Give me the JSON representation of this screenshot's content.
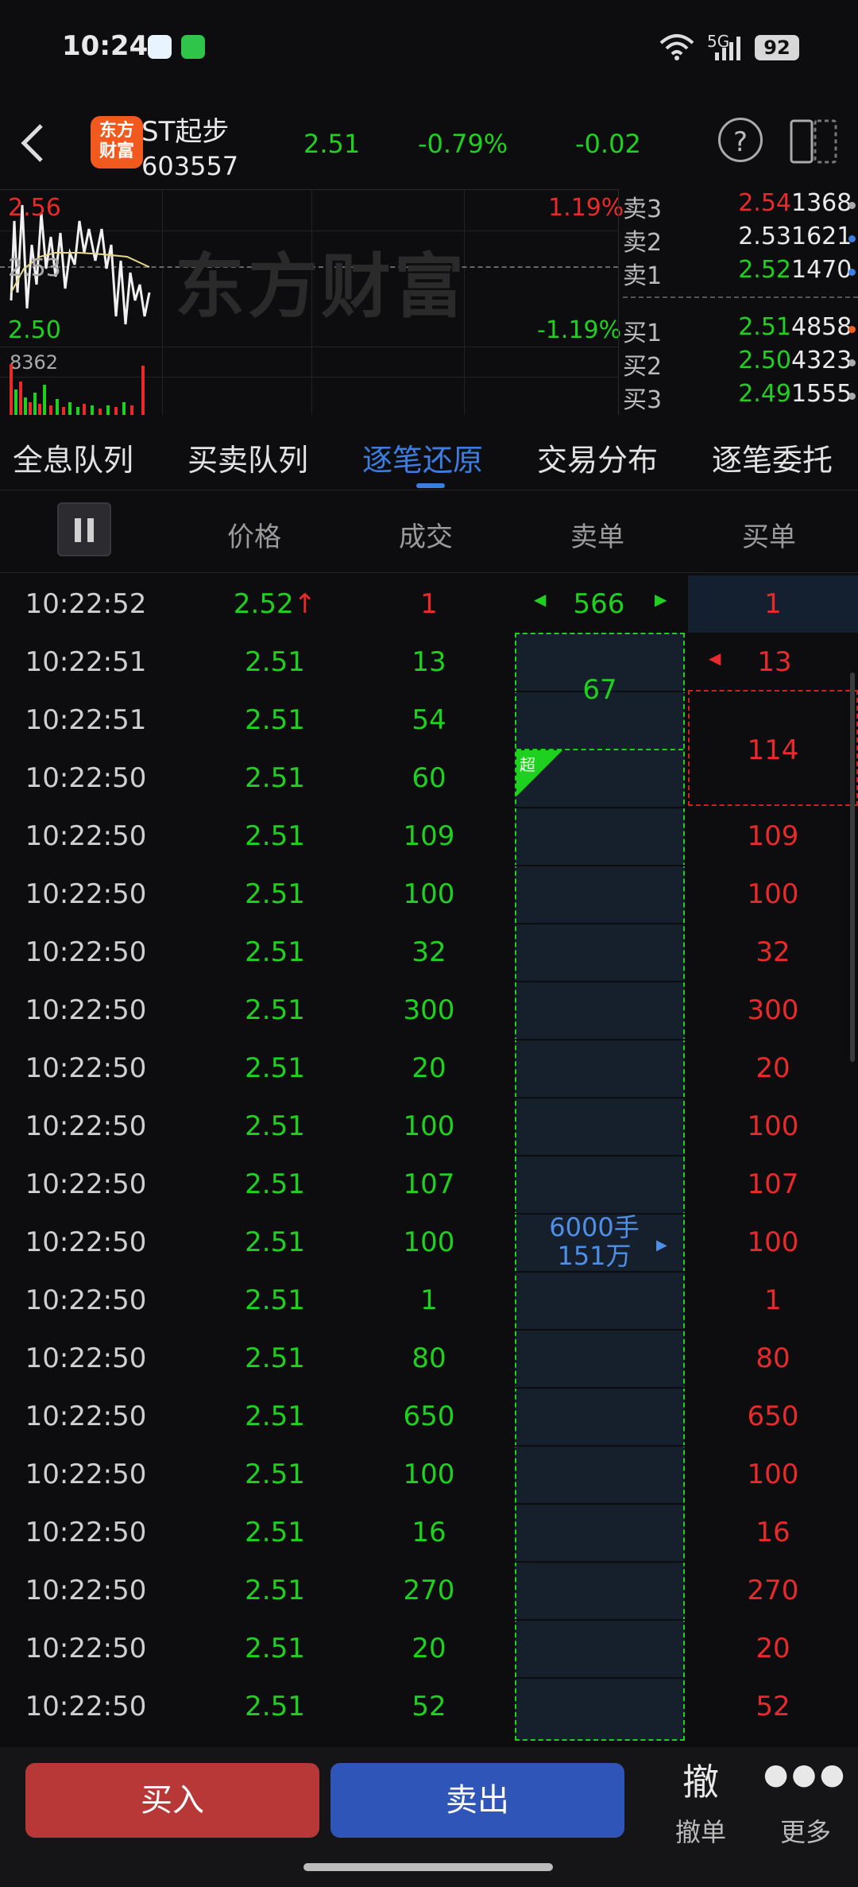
{
  "status_bar": {
    "time": "10:24",
    "signal": "5G",
    "battery": "92"
  },
  "header": {
    "logo": "东方\n财富",
    "name": "ST起步",
    "code": "603557",
    "price": "2.51",
    "change_pct": "-0.79%",
    "change": "-0.02",
    "help": "?"
  },
  "chart": {
    "high": "2.56",
    "prev": "2.53",
    "low": "2.50",
    "high_pct": "1.19%",
    "low_pct": "-1.19%",
    "volume": "8362",
    "watermark": "东方财富"
  },
  "order_book": {
    "asks": [
      {
        "label": "卖3",
        "price": "2.54",
        "vol": "1368",
        "price_color": "#e82a2a",
        "dot": "#aaaaaa"
      },
      {
        "label": "卖2",
        "price": "2.53",
        "vol": "1621",
        "price_color": "#e6e6e6",
        "dot": "#3b7de0"
      },
      {
        "label": "卖1",
        "price": "2.52",
        "vol": "1470",
        "price_color": "#1fd11f",
        "dot": "#3b7de0"
      }
    ],
    "bids": [
      {
        "label": "买1",
        "price": "2.51",
        "vol": "4858",
        "price_color": "#1fd11f",
        "dot": "#f06020"
      },
      {
        "label": "买2",
        "price": "2.50",
        "vol": "4323",
        "price_color": "#1fd11f",
        "dot": "#aaaaaa"
      },
      {
        "label": "买3",
        "price": "2.49",
        "vol": "1555",
        "price_color": "#1fd11f",
        "dot": "#aaaaaa"
      }
    ]
  },
  "tabs": [
    "全息队列",
    "买卖队列",
    "逐笔还原",
    "交易分布",
    "逐笔委托"
  ],
  "columns": {
    "price": "价格",
    "deal": "成交",
    "sell": "卖单",
    "buy": "买单"
  },
  "first_row": {
    "time": "10:22:52",
    "price": "2.52",
    "vol": "1",
    "sell": "566",
    "buy": "1"
  },
  "rows": [
    {
      "time": "10:22:51",
      "price": "2.51",
      "vol": "13",
      "buy": "13"
    },
    {
      "time": "10:22:51",
      "price": "2.51",
      "vol": "54",
      "buy": ""
    },
    {
      "time": "10:22:50",
      "price": "2.51",
      "vol": "60",
      "buy": ""
    },
    {
      "time": "10:22:50",
      "price": "2.51",
      "vol": "109",
      "buy": "109"
    },
    {
      "time": "10:22:50",
      "price": "2.51",
      "vol": "100",
      "buy": "100"
    },
    {
      "time": "10:22:50",
      "price": "2.51",
      "vol": "32",
      "buy": "32"
    },
    {
      "time": "10:22:50",
      "price": "2.51",
      "vol": "300",
      "buy": "300"
    },
    {
      "time": "10:22:50",
      "price": "2.51",
      "vol": "20",
      "buy": "20"
    },
    {
      "time": "10:22:50",
      "price": "2.51",
      "vol": "100",
      "buy": "100"
    },
    {
      "time": "10:22:50",
      "price": "2.51",
      "vol": "107",
      "buy": "107"
    },
    {
      "time": "10:22:50",
      "price": "2.51",
      "vol": "100",
      "buy": "100"
    },
    {
      "time": "10:22:50",
      "price": "2.51",
      "vol": "1",
      "buy": "1"
    },
    {
      "time": "10:22:50",
      "price": "2.51",
      "vol": "80",
      "buy": "80"
    },
    {
      "time": "10:22:50",
      "price": "2.51",
      "vol": "650",
      "buy": "650"
    },
    {
      "time": "10:22:50",
      "price": "2.51",
      "vol": "100",
      "buy": "100"
    },
    {
      "time": "10:22:50",
      "price": "2.51",
      "vol": "16",
      "buy": "16"
    },
    {
      "time": "10:22:50",
      "price": "2.51",
      "vol": "270",
      "buy": "270"
    },
    {
      "time": "10:22:50",
      "price": "2.51",
      "vol": "20",
      "buy": "20"
    },
    {
      "time": "10:22:50",
      "price": "2.51",
      "vol": "52",
      "buy": "52"
    }
  ],
  "sell_blocks": {
    "small": "67",
    "super_tag": "超",
    "big_line1": "6000手",
    "big_line2": "151万"
  },
  "buy_merged": "114",
  "bottom": {
    "buy": "买入",
    "sell": "卖出",
    "cancel_icon": "撤",
    "cancel": "撤单",
    "more": "更多"
  }
}
